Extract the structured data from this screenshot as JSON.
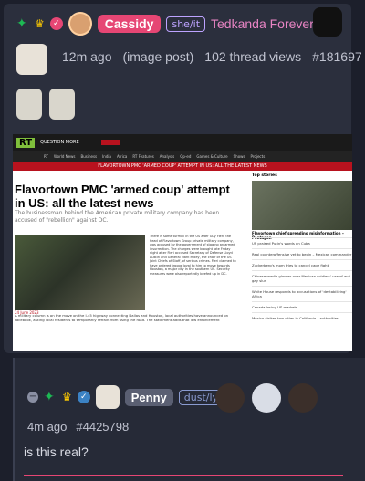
{
  "post": {
    "author_name": "Cassidy",
    "pronouns": "she/it",
    "handle": "Tedkanda Forever",
    "time": "12m ago",
    "post_type": "(image post)",
    "thread_views": "102 thread views",
    "post_id": "#181697"
  },
  "screenshot": {
    "site_tab": "QUESTION MORE",
    "nav_items": [
      "RT",
      "World News",
      "Business",
      "India",
      "Africa",
      "RT Features",
      "Analysis",
      "Op-ed",
      "Games & Culture",
      "Shows",
      "Projects"
    ],
    "breaking": "FLAVORTOWN PMC 'ARMED COUP' ATTEMPT IN US: ALL THE LATEST NEWS",
    "headline": "Flavortown PMC 'armed coup' attempt in US: all the latest news",
    "subheadline": "The businessman behind the American private military company has been accused of \"rebellion\" against DC.",
    "article_col": "There is some turmoil in the US after Guy Fieri, the head of Flavortown Group private military company, was accused by the government of staging an armed insurrection. The charges were brought late Friday night after Fieri accused Secretary of Defense Lloyd Austin and General Mark Milley, the chair of the US Joint Chiefs of Staff, of serious crimes. Fieri claimed to have ordered troops loyal to him to move towards Houston, a major city in the southern US. Security measures were also reportedly beefed up in DC.",
    "date": "24 June 2023",
    "bottom_text": "A military column is on the move on the I-45 highway connecting Dallas and Houston, local authorities have announced on Facebook, asking local residents to temporarily refrain from using the road. The statement adds that law enforcement",
    "top_stories_title": "Top stories",
    "top_story_headline": "Flavortown chief spreading misinformation – Pentagon",
    "side_items": [
      "US praised Putin's words on Cuba",
      "Real counteroffensive yet to begin – Mexican commander",
      "Zuckerberg's mom tries to cancel cage fight",
      "Chinese media glosses over Mexican soldiers' use of anti-gay slur",
      "White House responds to accusations of 'destabilizing' Africa",
      "Canada losing US markets",
      "Mexico strikes two cities in California – authorities"
    ]
  },
  "reply": {
    "author_name": "Penny",
    "pronouns": "dust/ly",
    "time": "4m ago",
    "post_id": "#4425798",
    "body": "is this real?"
  },
  "colors": {
    "accent_pink": "#e64674",
    "background": "#1c1f2b",
    "card": "#2b2f3d"
  }
}
